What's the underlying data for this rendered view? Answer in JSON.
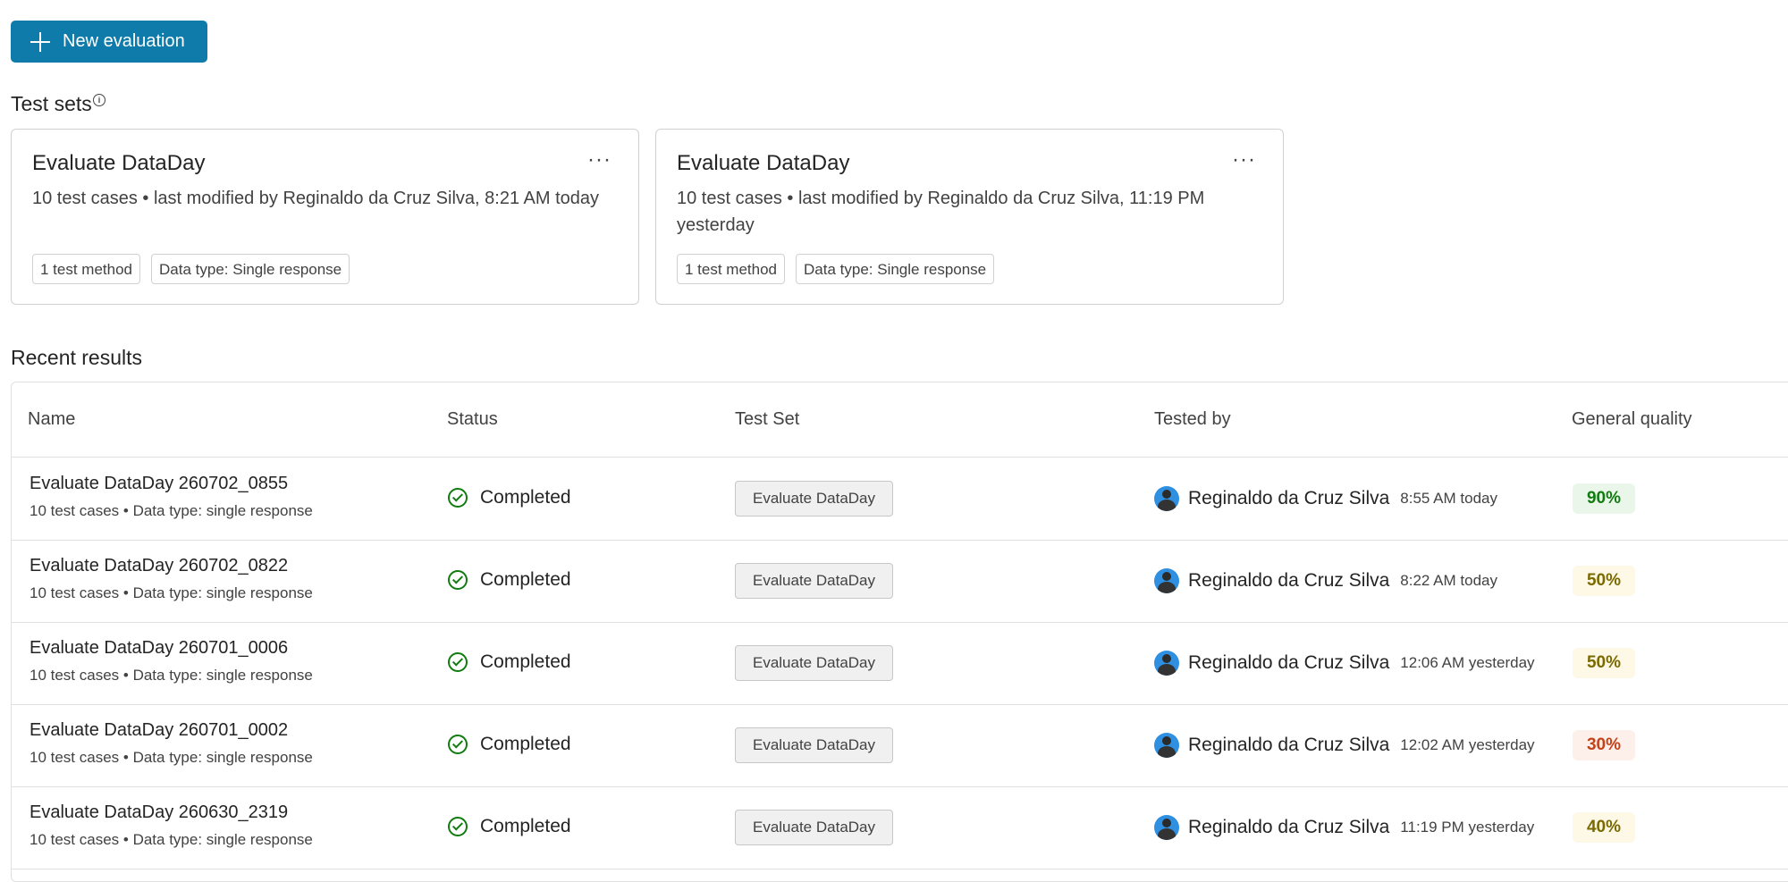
{
  "toolbar": {
    "new_evaluation_label": "New evaluation"
  },
  "test_sets": {
    "title": "Test sets",
    "info_icon": "i",
    "cards": [
      {
        "title": "Evaluate DataDay",
        "menu": "···",
        "description": "10 test cases • last modified by Reginaldo da Cruz Silva, 8:21 AM today",
        "chips": [
          "1 test method",
          "Data type: Single response"
        ]
      },
      {
        "title": "Evaluate DataDay",
        "menu": "···",
        "description": "10 test cases • last modified by Reginaldo da Cruz Silva, 11:19 PM yesterday",
        "chips": [
          "1 test method",
          "Data type: Single response"
        ]
      }
    ]
  },
  "recent_results": {
    "title": "Recent results",
    "columns": [
      "Name",
      "Status",
      "Test Set",
      "Tested by",
      "General quality"
    ],
    "rows": [
      {
        "name": "Evaluate DataDay 260702_0855",
        "subtitle": "10 test cases • Data type: single response",
        "status": "Completed",
        "test_set": "Evaluate DataDay",
        "tested_by": "Reginaldo da Cruz Silva",
        "time": "8:55 AM today",
        "quality": "90%",
        "quality_color": "#107c10",
        "quality_bg": "#e9f6e9"
      },
      {
        "name": "Evaluate DataDay 260702_0822",
        "subtitle": "10 test cases • Data type: single response",
        "status": "Completed",
        "test_set": "Evaluate DataDay",
        "tested_by": "Reginaldo da Cruz Silva",
        "time": "8:22 AM today",
        "quality": "50%",
        "quality_color": "#7a6a00",
        "quality_bg": "#fdf9e6"
      },
      {
        "name": "Evaluate DataDay 260701_0006",
        "subtitle": "10 test cases • Data type: single response",
        "status": "Completed",
        "test_set": "Evaluate DataDay",
        "tested_by": "Reginaldo da Cruz Silva",
        "time": "12:06 AM yesterday",
        "quality": "50%",
        "quality_color": "#7a6a00",
        "quality_bg": "#fdf9e6"
      },
      {
        "name": "Evaluate DataDay 260701_0002",
        "subtitle": "10 test cases • Data type: single response",
        "status": "Completed",
        "test_set": "Evaluate DataDay",
        "tested_by": "Reginaldo da Cruz Silva",
        "time": "12:02 AM yesterday",
        "quality": "30%",
        "quality_color": "#c4421a",
        "quality_bg": "#fdf0eb"
      },
      {
        "name": "Evaluate DataDay 260630_2319",
        "subtitle": "10 test cases • Data type: single response",
        "status": "Completed",
        "test_set": "Evaluate DataDay",
        "tested_by": "Reginaldo da Cruz Silva",
        "time": "11:19 PM yesterday",
        "quality": "40%",
        "quality_color": "#7a6a00",
        "quality_bg": "#fdf9e6"
      }
    ]
  }
}
